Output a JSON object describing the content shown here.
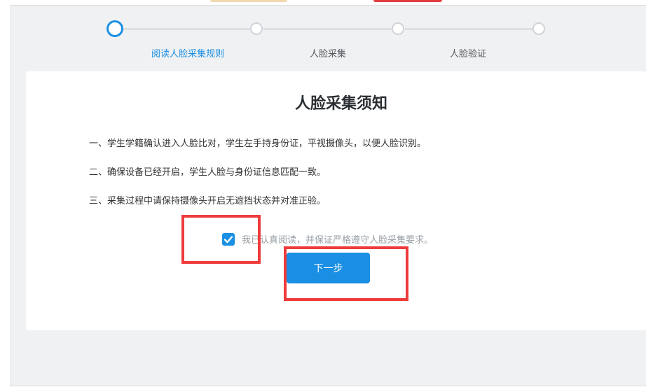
{
  "steps": [
    {
      "label": "阅读人脸采集规则",
      "state": "active"
    },
    {
      "label": "人脸采集",
      "state": "pending"
    },
    {
      "label": "人脸验证",
      "state": "pending"
    }
  ],
  "notice": {
    "title": "人脸采集须知",
    "rules": [
      "一、学生学籍确认进入人脸比对，学生左手持身份证，平视摄像头，以便人脸识别。",
      "二、确保设备已经开启，学生人脸与身份证信息匹配一致。",
      "三、采集过程中请保持摄像头开启无遮挡状态并对准正验。"
    ]
  },
  "agreement": {
    "checked": true,
    "text": "我已认真阅读，并保证严格遵守人脸采集要求。"
  },
  "actions": {
    "next_label": "下一步"
  },
  "colors": {
    "accent": "#1a8fe3",
    "highlight": "#ee3b3b"
  }
}
